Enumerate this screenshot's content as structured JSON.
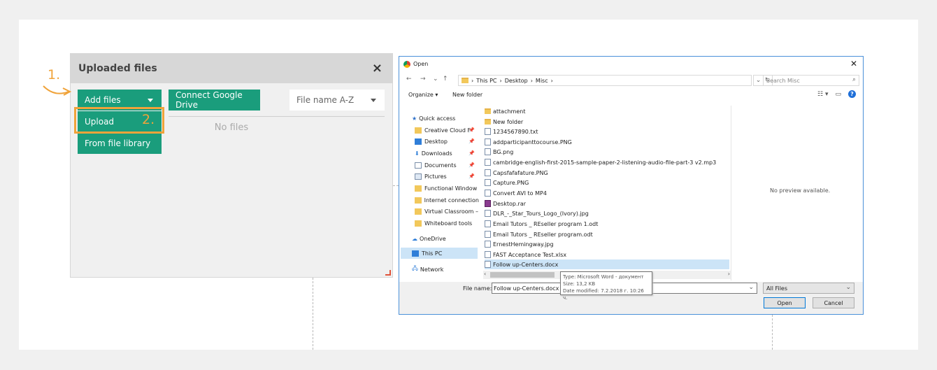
{
  "panel": {
    "title": "Uploaded files",
    "close_glyph": "×",
    "add_files_label": "Add files",
    "connect_drive_label": "Connect Google Drive",
    "upload_label": "Upload",
    "library_label": "From file library",
    "sort_value": "File name A-Z",
    "no_files": "No files"
  },
  "steps": {
    "one": "1.",
    "two": "2."
  },
  "dialog": {
    "title": "Open",
    "close_glyph": "✕",
    "breadcrumb": [
      "This PC",
      "Desktop",
      "Misc"
    ],
    "search_placeholder": "Search Misc",
    "organize_label": "Organize ▾",
    "new_folder_label": "New folder",
    "nav": [
      {
        "label": "Quick access",
        "icon": "star-icon"
      },
      {
        "label": "Creative Cloud F",
        "icon": "folder-icon",
        "pinned": true
      },
      {
        "label": "Desktop",
        "icon": "desktop-icon",
        "pinned": true
      },
      {
        "label": "Downloads",
        "icon": "download-icon",
        "pinned": true
      },
      {
        "label": "Documents",
        "icon": "documents-icon",
        "pinned": true
      },
      {
        "label": "Pictures",
        "icon": "pictures-icon",
        "pinned": true
      },
      {
        "label": "Functional Window",
        "icon": "folder-icon"
      },
      {
        "label": "Internet connection",
        "icon": "folder-icon"
      },
      {
        "label": "Virtual Classroom –",
        "icon": "folder-icon"
      },
      {
        "label": "Whiteboard tools",
        "icon": "folder-icon"
      },
      {
        "label": "OneDrive",
        "icon": "onedrive-icon"
      },
      {
        "label": "This PC",
        "icon": "pc-icon"
      },
      {
        "label": "Network",
        "icon": "network-icon"
      }
    ],
    "files": [
      {
        "name": "attachment",
        "type": "folder"
      },
      {
        "name": "New folder",
        "type": "folder"
      },
      {
        "name": "1234567890.txt",
        "type": "file"
      },
      {
        "name": "addparticipanttocourse.PNG",
        "type": "file"
      },
      {
        "name": "BG.png",
        "type": "file"
      },
      {
        "name": "cambridge-english-first-2015-sample-paper-2-listening-audio-file-part-3 v2.mp3",
        "type": "file"
      },
      {
        "name": "Capsfafafature.PNG",
        "type": "file"
      },
      {
        "name": "Capture.PNG",
        "type": "file"
      },
      {
        "name": "Convert AVI to MP4",
        "type": "file"
      },
      {
        "name": "Desktop.rar",
        "type": "file"
      },
      {
        "name": "DLR_-_Star_Tours_Logo_(Ivory).jpg",
        "type": "file"
      },
      {
        "name": "Email Tutors _ REseller program 1.odt",
        "type": "file"
      },
      {
        "name": "Email Tutors _ REseller program.odt",
        "type": "file"
      },
      {
        "name": "ErnestHemingway.jpg",
        "type": "file"
      },
      {
        "name": "FAST Acceptance Test.xlsx",
        "type": "file"
      },
      {
        "name": "Follow up-Centers.docx",
        "type": "file",
        "selected": true
      }
    ],
    "preview_text": "No preview available.",
    "filename_label": "File name:",
    "filename_value": "Follow up-Centers.docx",
    "filetype_value": "All Files",
    "open_label": "Open",
    "cancel_label": "Cancel",
    "tooltip": {
      "type": "Type: Microsoft Word - документ",
      "size": "Size: 13,2 KB",
      "modified": "Date modified: 7.2.2018 г. 10:26 ч."
    }
  },
  "colors": {
    "green": "#1a9d7c",
    "orange": "#f0a33a",
    "selection": "#cce4f7"
  }
}
